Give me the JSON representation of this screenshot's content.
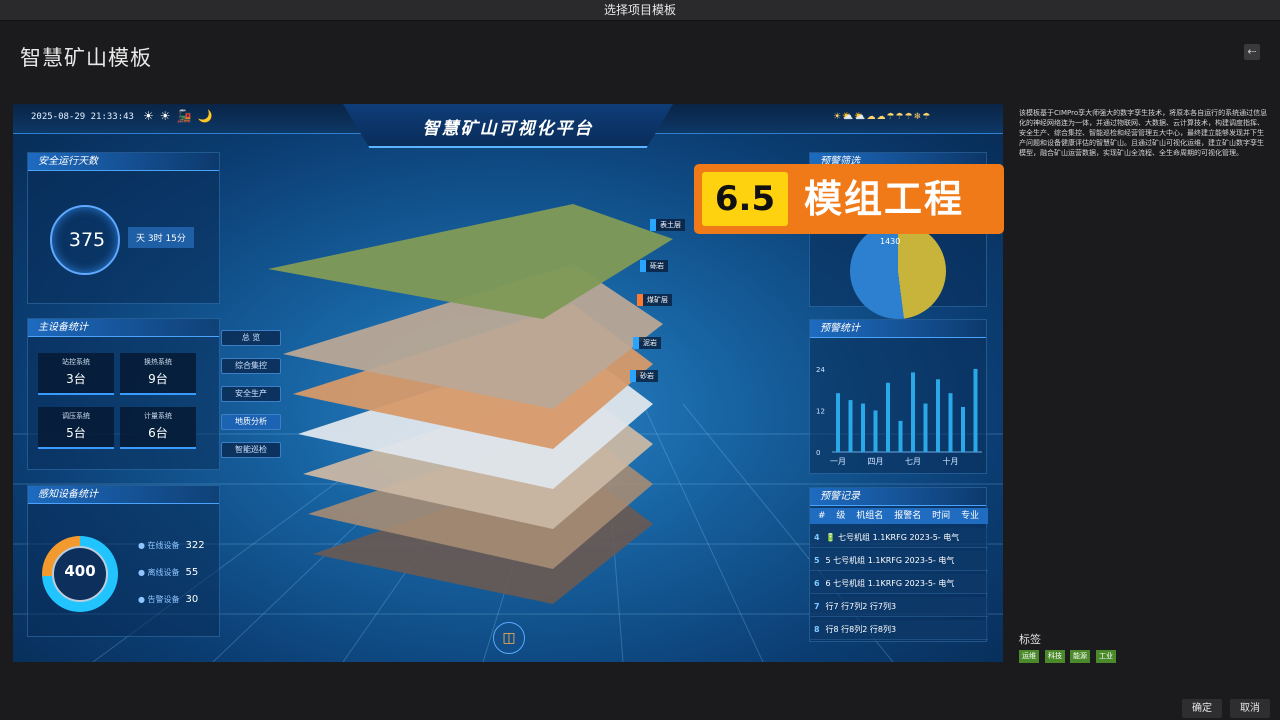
{
  "window": {
    "title": "选择项目模板"
  },
  "page": {
    "title": "智慧矿山模板",
    "back_icon": "arrow-left-icon"
  },
  "preview": {
    "datetime": "2025-08-29 21:33:43",
    "weather_left_icons": "☀☀🚂🌙",
    "weather_right_icons": "☀⛅⛅☁☁☂☂☂❄☂",
    "title": "智慧矿山可视化平台",
    "safety_days": {
      "title": "安全运行天数",
      "value": "375",
      "detail": "天 3时 15分"
    },
    "main_devices": {
      "title": "主设备统计",
      "items": [
        {
          "name": "站控系统",
          "value": "3台"
        },
        {
          "name": "换热系统",
          "value": "9台"
        },
        {
          "name": "调压系统",
          "value": "5台"
        },
        {
          "name": "计量系统",
          "value": "6台"
        }
      ]
    },
    "sensor_devices": {
      "title": "感知设备统计",
      "total": "400",
      "online_fraction": 0.74,
      "rows": [
        {
          "label": "在线设备",
          "value": "322"
        },
        {
          "label": "离线设备",
          "value": "55"
        },
        {
          "label": "告警设备",
          "value": "30"
        }
      ]
    },
    "menu": [
      {
        "label": "总 览",
        "active": false
      },
      {
        "label": "综合集控",
        "active": false
      },
      {
        "label": "安全生产",
        "active": false
      },
      {
        "label": "地质分析",
        "active": true
      },
      {
        "label": "智能巡检",
        "active": false
      }
    ],
    "layers": [
      {
        "label": "表土层",
        "warm": false
      },
      {
        "label": "砾岩",
        "warm": false
      },
      {
        "label": "煤矿层",
        "warm": true
      },
      {
        "label": "泥岩",
        "warm": false
      },
      {
        "label": "砂岩",
        "warm": false
      }
    ],
    "warning_filter": {
      "title": "预警筛选",
      "center_value": "1430"
    },
    "warning_stats": {
      "title": "预警统计",
      "colors": {
        "bar": "#2aa8e8"
      }
    },
    "warning_records": {
      "title": "预警记录",
      "headers": [
        "#",
        "级",
        "机组名",
        "报警名",
        "时间",
        "专业"
      ],
      "rows": [
        {
          "n": "4",
          "text": "🔋 七号机组 1.1KRFG 2023-5- 电气"
        },
        {
          "n": "5",
          "text": "5 七号机组 1.1KRFG 2023-5- 电气"
        },
        {
          "n": "6",
          "text": "6 七号机组 1.1KRFG 2023-5- 电气"
        },
        {
          "n": "7",
          "text": "行7 行7列2 行7列3"
        },
        {
          "n": "8",
          "text": "行8 行8列2 行8列3"
        }
      ]
    },
    "bottom_icon": "cube-icon"
  },
  "chart_data": {
    "type": "bar",
    "title": "预警统计",
    "categories": [
      "一月",
      "",
      "",
      "四月",
      "",
      "",
      "七月",
      "",
      "",
      "十月",
      "",
      ""
    ],
    "tick_labels": [
      "一月",
      "四月",
      "七月",
      "十月"
    ],
    "yticks": [
      "0",
      "12",
      "24"
    ],
    "values": [
      17,
      15,
      14,
      12,
      20,
      9,
      23,
      14,
      21,
      17,
      13,
      24
    ],
    "ylim": [
      0,
      26
    ]
  },
  "badge": {
    "number": "6.5",
    "text": "模组工程"
  },
  "description": "该模板基于CIMPro孪大师强大的数字孪生技术，将原本各自运行的系统通过信息化的神经网络连为一体，并通过物联网、大数据、云计算技术，构建调度指挥、安全生产、综合集控、智能巡检和经营管理五大中心，最终建立能够发现并下生产问题和设备健康评估的智慧矿山。且通过矿山可视化运维，建立矿山数字孪生模型，融合矿山运营数据，实现矿山全流程、全生命周期的可视化管理。",
  "tags": {
    "label": "标签",
    "items": [
      "运维",
      "科技",
      "能源",
      "工业"
    ]
  },
  "actions": {
    "confirm": "确定",
    "cancel": "取消"
  }
}
